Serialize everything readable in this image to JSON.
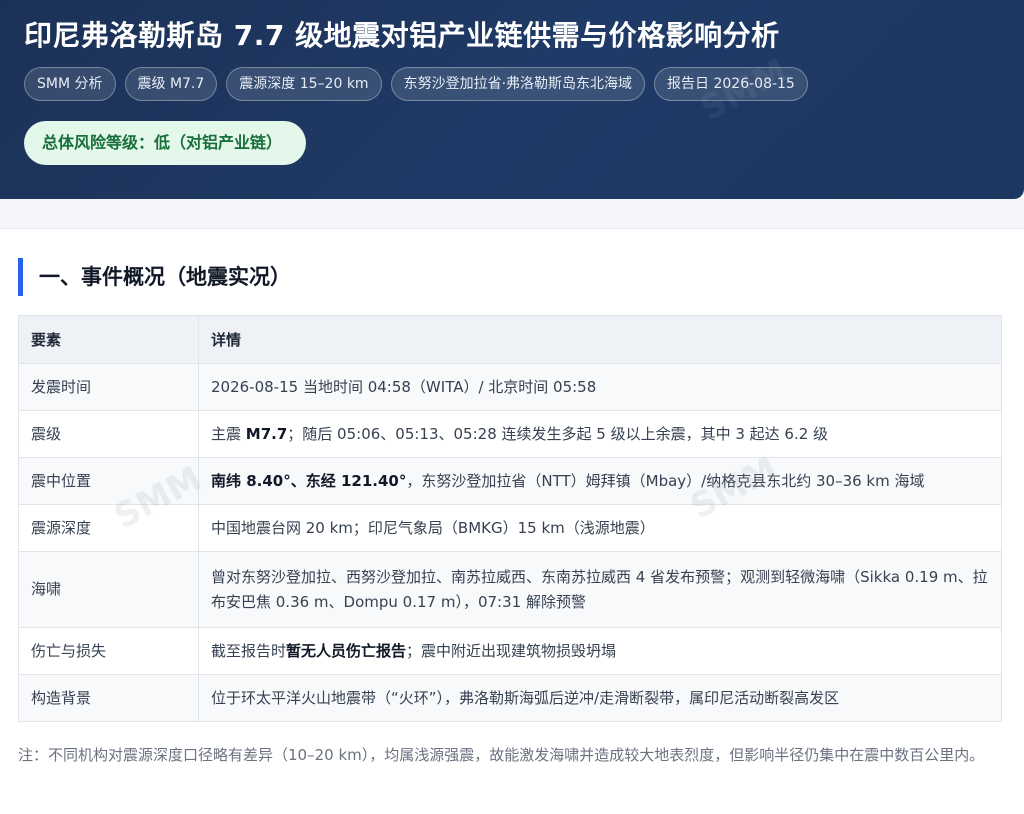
{
  "header": {
    "title": "印尼弗洛勒斯岛 7.7 级地震对铝产业链供需与价格影响分析",
    "tags": [
      "SMM 分析",
      "震级 M7.7",
      "震源深度 15–20 km",
      "东努沙登加拉省·弗洛勒斯岛东北海域",
      "报告日 2026-08-15"
    ],
    "risk_badge": "总体风险等级：低（对铝产业链）"
  },
  "section": {
    "title": "一、事件概况（地震实况）"
  },
  "table": {
    "columns": [
      "要素",
      "详情"
    ],
    "rows": [
      {
        "key": "发震时间",
        "pre": "2026-08-15 当地时间 04:58（WITA）/ 北京时间 05:58",
        "bold": "",
        "post": ""
      },
      {
        "key": "震级",
        "pre": "主震 ",
        "bold": "M7.7",
        "post": "；随后 05:06、05:13、05:28 连续发生多起 5 级以上余震，其中 3 起达 6.2 级"
      },
      {
        "key": "震中位置",
        "pre": "",
        "bold": "南纬 8.40°、东经 121.40°",
        "post": "，东努沙登加拉省（NTT）姆拜镇（Mbay）/纳格克县东北约 30–36 km 海域"
      },
      {
        "key": "震源深度",
        "pre": "中国地震台网 20 km；印尼气象局（BMKG）15 km（浅源地震）",
        "bold": "",
        "post": ""
      },
      {
        "key": "海啸",
        "pre": "曾对东努沙登加拉、西努沙登加拉、南苏拉威西、东南苏拉威西 4 省发布预警；观测到轻微海啸（Sikka 0.19 m、拉布安巴焦 0.36 m、Dompu 0.17 m），07:31 解除预警",
        "bold": "",
        "post": ""
      },
      {
        "key": "伤亡与损失",
        "pre": "截至报告时",
        "bold": "暂无人员伤亡报告",
        "post": "；震中附近出现建筑物损毁坍塌"
      },
      {
        "key": "构造背景",
        "pre": "位于环太平洋火山地震带（“火环”），弗洛勒斯海弧后逆冲/走滑断裂带，属印尼活动断裂高发区",
        "bold": "",
        "post": ""
      }
    ]
  },
  "note": "注：不同机构对震源深度口径略有差异（10–20 km），均属浅源强震，故能激发海啸并造成较大地表烈度，但影响半径仍集中在震中数百公里内。",
  "watermark": "SMM"
}
